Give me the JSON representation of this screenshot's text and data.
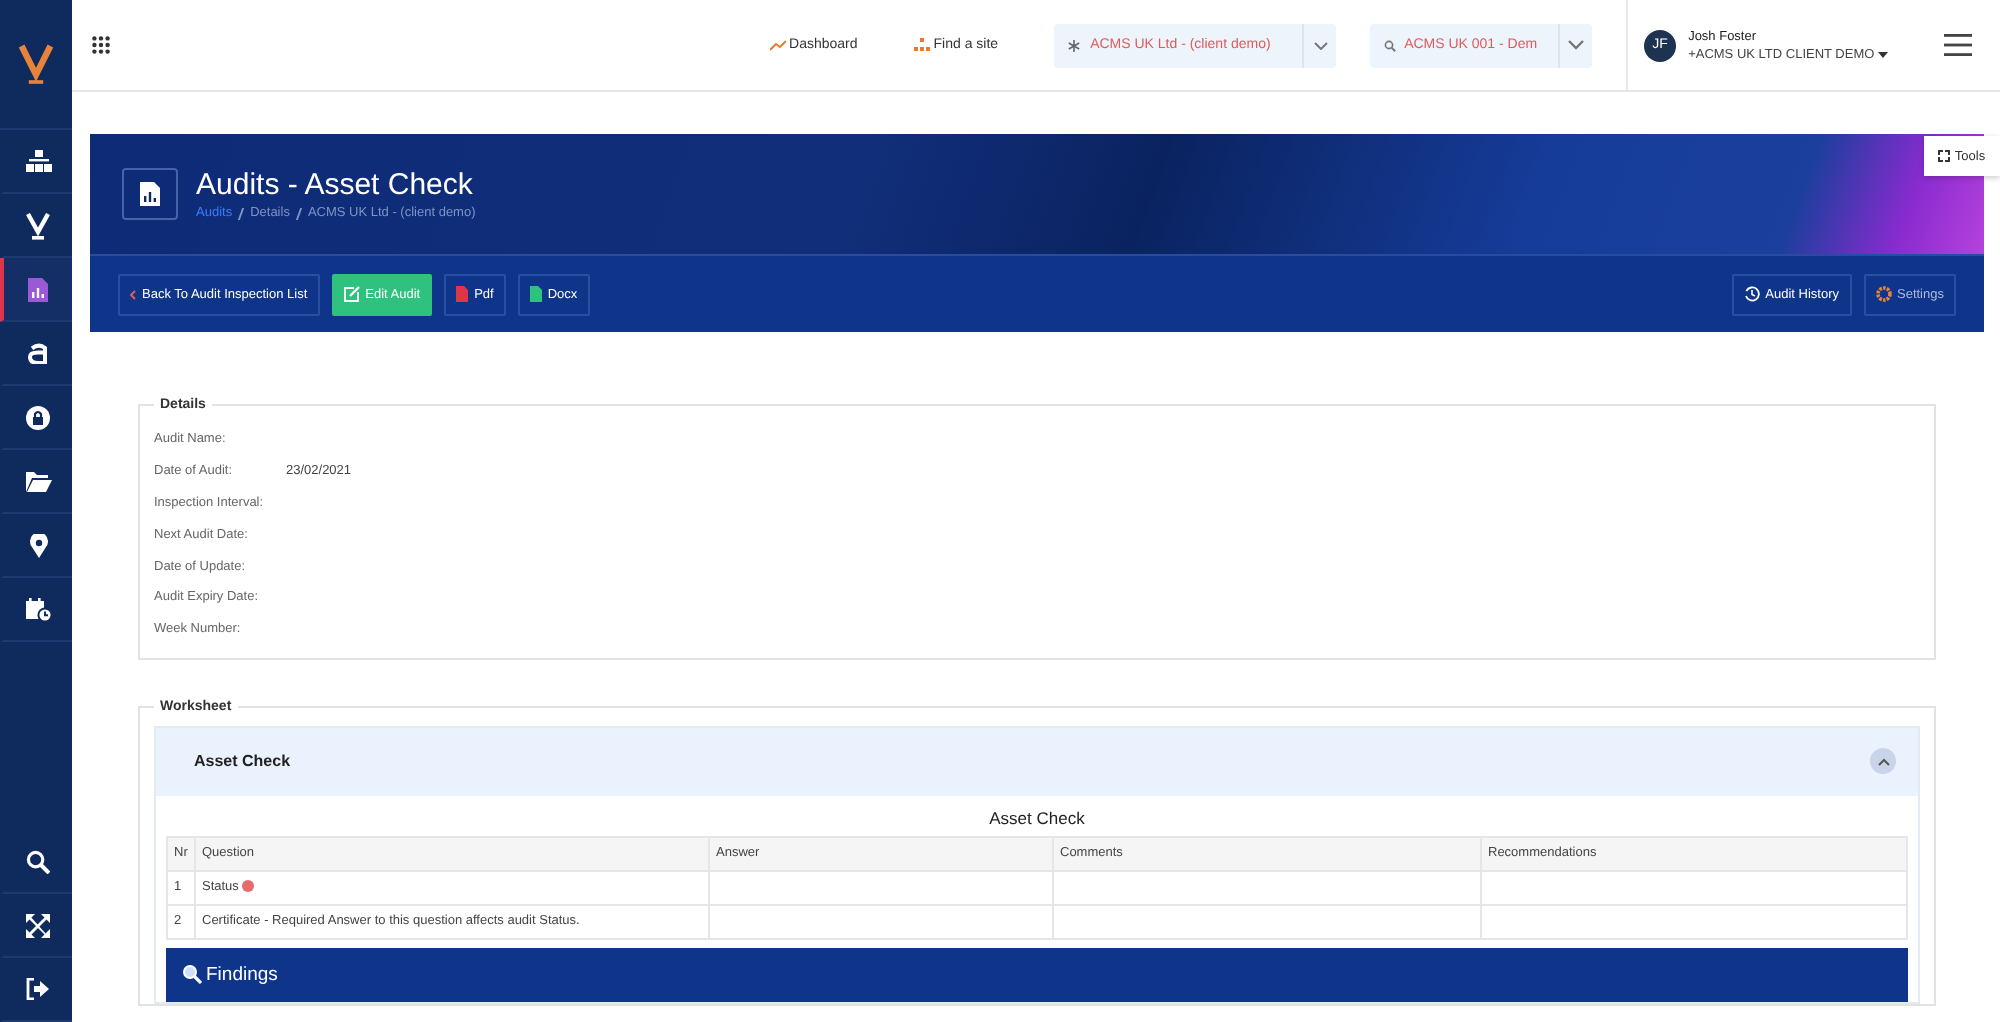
{
  "sidebar": {
    "items": [
      {
        "kind": "sitemap",
        "selected": false
      },
      {
        "kind": "v-mark",
        "selected": false
      },
      {
        "kind": "report",
        "selected": true
      },
      {
        "kind": "letter",
        "selected": false
      },
      {
        "kind": "lock",
        "selected": false
      },
      {
        "kind": "folder",
        "selected": false
      },
      {
        "kind": "pin",
        "selected": false
      },
      {
        "kind": "calendar",
        "selected": false
      }
    ],
    "bottom_items": [
      {
        "kind": "search"
      },
      {
        "kind": "expand"
      },
      {
        "kind": "logout"
      }
    ]
  },
  "header": {
    "nav_links": [
      {
        "label": "Dashboard",
        "kind": "chart"
      },
      {
        "label": "Find a site",
        "kind": "sitemap"
      }
    ],
    "company_select": {
      "value": "ACMS UK Ltd - (client demo)"
    },
    "site_select": {
      "value": "ACMS UK 001 -  Dem"
    },
    "user": {
      "initials": "JF",
      "name": "Josh Foster",
      "organisation": "+ACMS UK LTD CLIENT DEMO"
    }
  },
  "tools_tab": {
    "label": "Tools"
  },
  "page": {
    "title": "Audits - Asset Check",
    "breadcrumb": [
      "Audits",
      "Details",
      "ACMS UK Ltd - (client demo)"
    ]
  },
  "toolbar": {
    "left": [
      {
        "label": "Back To Audit Inspection List",
        "kind": "back"
      },
      {
        "label": "Edit Audit",
        "kind": "edit"
      },
      {
        "label": "Pdf",
        "kind": "pdf"
      },
      {
        "label": "Docx",
        "kind": "docx"
      }
    ],
    "right": [
      {
        "label": "Audit History",
        "kind": "history"
      },
      {
        "label": "Settings",
        "kind": "settings"
      }
    ]
  },
  "details": {
    "title": "Details",
    "fields": [
      {
        "label": "Audit Name:"
      },
      {
        "label": "Date of Audit:",
        "value": "23/02/2021"
      },
      {
        "label": "Inspection Interval:"
      },
      {
        "label": "Next Audit Date:"
      },
      {
        "label": "Date of Update:"
      },
      {
        "label": "Audit Expiry Date:"
      },
      {
        "label": "Week Number:"
      }
    ]
  },
  "worksheet": {
    "title": "Worksheet",
    "section": {
      "title": "Asset Check",
      "expanded": true,
      "table_title": "Asset Check",
      "columns": [
        "Nr",
        "Question",
        "Answer",
        "Comments",
        "Recommendations"
      ],
      "rows": [
        {
          "nr": "1",
          "question": "Status",
          "required": true
        },
        {
          "nr": "2",
          "question": "Certificate - Required Answer to this question affects audit Status.",
          "required": false
        }
      ]
    },
    "findings": {
      "title": "Findings"
    }
  }
}
